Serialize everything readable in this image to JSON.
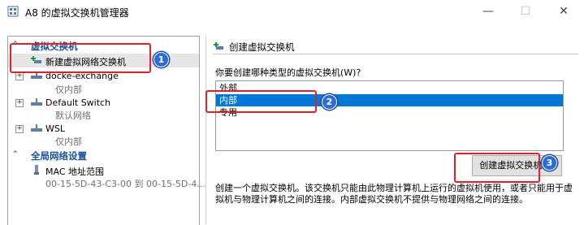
{
  "window": {
    "title": "A8 的虚拟交换机管理器",
    "min": "—",
    "max": "☐",
    "close": "✕"
  },
  "left": {
    "section1": "虚拟交换机",
    "new_switch": "新建虚拟网络交换机",
    "switches": [
      {
        "name": "docke-exchange",
        "type": "仅内部"
      },
      {
        "name": "Default Switch",
        "type": "默认网络"
      },
      {
        "name": "WSL",
        "type": "仅内部"
      }
    ],
    "section2": "全局网络设置",
    "mac": {
      "label": "MAC 地址范围",
      "value": "00-15-5D-43-C3-00 到 00-15-5D-4..."
    }
  },
  "right": {
    "heading": "创建虚拟交换机",
    "question": "你要创建哪种类型的虚拟交换机(W)?",
    "options": [
      "外部",
      "内部",
      "专用"
    ],
    "selected_option": "内部",
    "create_button": "创建虚拟交换机(S)",
    "description": "创建一个虚拟交换机。该交换机只能由此物理计算机上运行的虚拟机使用，或者只能用于虚拟机与物理计算机之间的连接。内部虚拟交换机不提供与物理网络之间的连接。"
  },
  "annotations": {
    "badges": [
      "1",
      "2",
      "3"
    ],
    "highlight_color": "#e0202a",
    "badge_color": "#2b6fd6"
  }
}
